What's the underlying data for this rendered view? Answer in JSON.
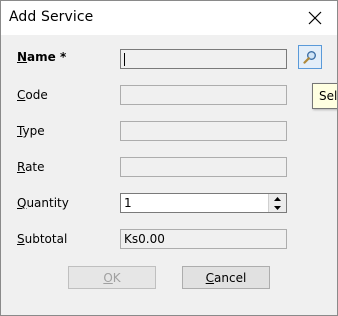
{
  "window": {
    "title": "Add Service"
  },
  "form": {
    "name_label_mnemonic": "N",
    "name_label_rest": "ame *",
    "name_value": "",
    "code_label_mnemonic": "C",
    "code_label_rest": "ode",
    "code_value": "",
    "type_label_mnemonic": "T",
    "type_label_rest": "ype",
    "type_value": "",
    "rate_label_mnemonic": "R",
    "rate_label_rest": "ate",
    "rate_value": "",
    "quantity_label_mnemonic": "Q",
    "quantity_label_rest": "uantity",
    "quantity_value": "1",
    "subtotal_label_mnemonic": "S",
    "subtotal_label_rest": "ubtotal",
    "subtotal_value": "Ks0.00"
  },
  "lookup": {
    "icon": "magnifier-icon",
    "tooltip": "Sele"
  },
  "buttons": {
    "ok_mnemonic": "O",
    "ok_rest": "K",
    "ok_enabled": false,
    "cancel_mnemonic": "C",
    "cancel_rest": "ancel",
    "cancel_enabled": true
  },
  "colors": {
    "lookup_border": "#5a9ad9",
    "tooltip_bg": "#ffffe1"
  }
}
